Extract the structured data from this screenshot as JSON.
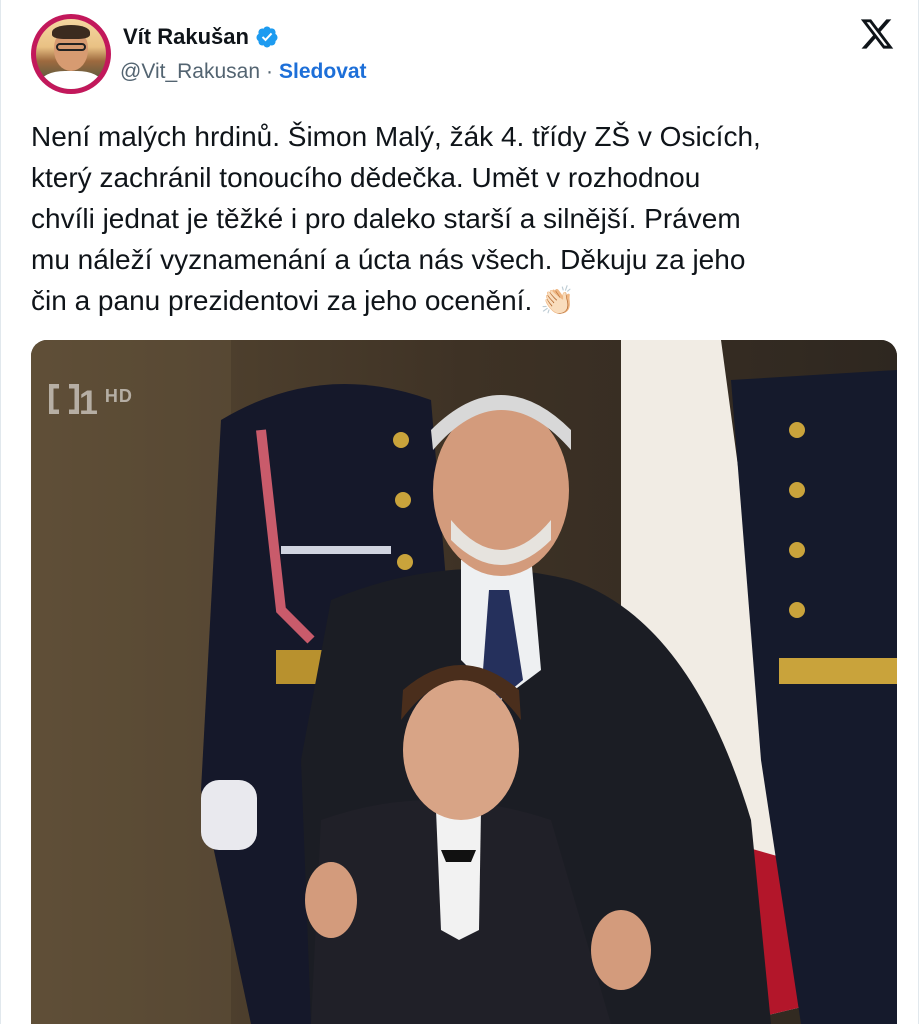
{
  "author": {
    "display_name": "Vít Rakušan",
    "handle": "@Vit_Rakusan",
    "separator": "·",
    "follow_label": "Sledovat",
    "verified_icon": "verified-badge-icon",
    "avatar_ring_color": "#c2185b"
  },
  "platform": {
    "logo_icon": "x-logo-icon"
  },
  "tweet": {
    "lines": [
      "Není malých hrdinů. Šimon Malý, žák 4. třídy ZŠ v Osicích,",
      "který zachránil tonoucího dědečka. Umět v rozhodnou",
      "chvíli jednat je těžké i pro daleko starší a silnější. Právem",
      "mu náleží vyznamenání a úcta nás všech. Děkuju za jeho",
      "čin a panu prezidentovi za jeho ocenění. 👏🏻"
    ]
  },
  "media": {
    "broadcast_logo": "1",
    "broadcast_logo_suffix": "HD"
  },
  "colors": {
    "link": "#1d6fd8",
    "text": "#0f1419",
    "secondary_text": "#536471",
    "verified": "#1d9bf0"
  }
}
